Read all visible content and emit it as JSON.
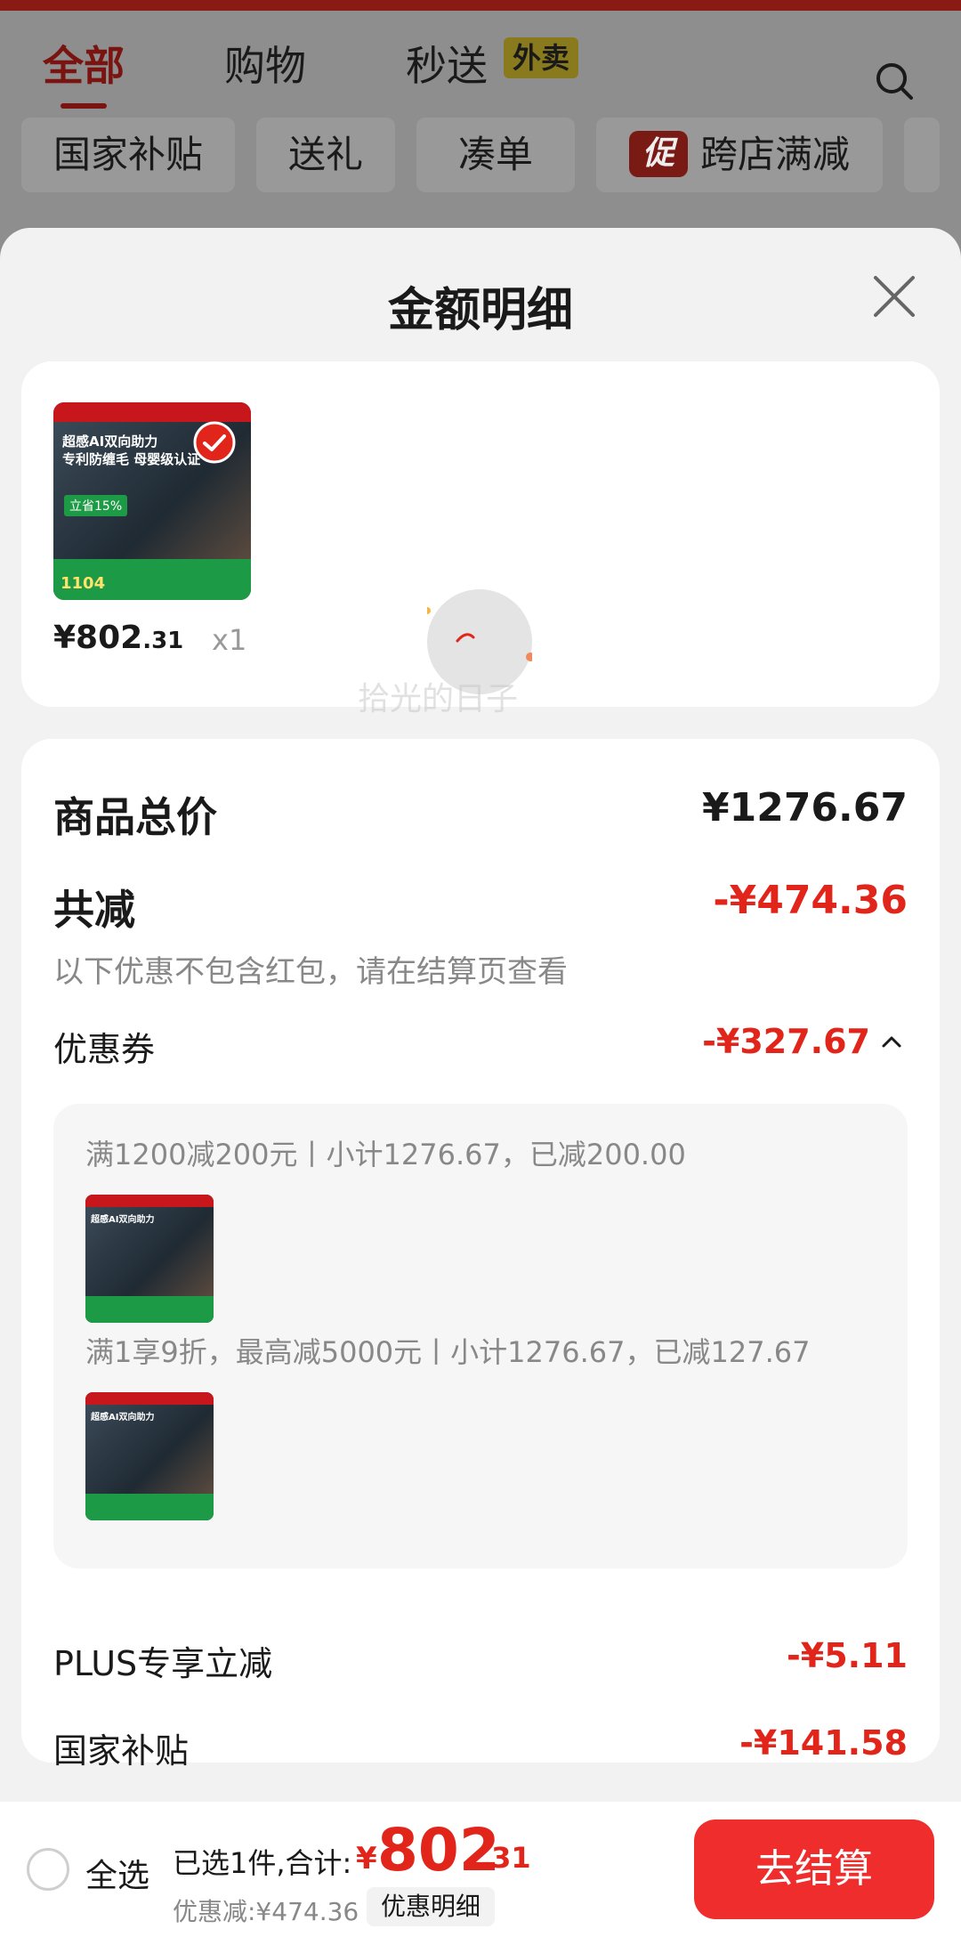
{
  "header": {
    "tabs": [
      {
        "label": "全部",
        "active": true
      },
      {
        "label": "购物",
        "active": false
      },
      {
        "label": "秒送",
        "active": false
      }
    ],
    "waimai_badge": "外卖",
    "chips": [
      "国家补贴",
      "送礼",
      "凑单",
      "跨店满减"
    ],
    "promo_tag": "促"
  },
  "sheet": {
    "title": "金额明细",
    "product": {
      "thumb_lines": [
        "超感AI双向助力",
        "专利防缠毛 母婴级认证"
      ],
      "thumb_badge": "立省15%",
      "thumb_price": "1104",
      "price_main": "¥802",
      "price_cents": ".31",
      "qty": "x1"
    },
    "summary": {
      "total_label": "商品总价",
      "total_value": "¥1276.67",
      "discount_label": "共减",
      "discount_value": "-¥474.36",
      "note": "以下优惠不包含红包，请在结算页查看",
      "coupon_label": "优惠券",
      "coupon_value": "-¥327.67",
      "coupon_rules": [
        "满1200减200元丨小计1276.67，已减200.00",
        "满1享9折，最高减5000元丨小计1276.67，已减127.67"
      ],
      "mini_thumb_text": "超感AI双向助力",
      "plus_label": "PLUS专享立减",
      "plus_value": "-¥5.11",
      "subsidy_label": "国家补贴",
      "subsidy_value": "-¥141.58"
    },
    "watermark": "拾光的日子"
  },
  "bottom": {
    "select_all": "全选",
    "selected_text": "已选1件,合计:",
    "total_symbol": "¥",
    "total_int": "802",
    "total_dec": ".31",
    "discount_text": "优惠减:¥474.36",
    "detail_button": "优惠明细",
    "checkout_button": "去结算"
  },
  "colors": {
    "accent_red": "#e1251b",
    "checkout_red": "#ef2d2d"
  }
}
